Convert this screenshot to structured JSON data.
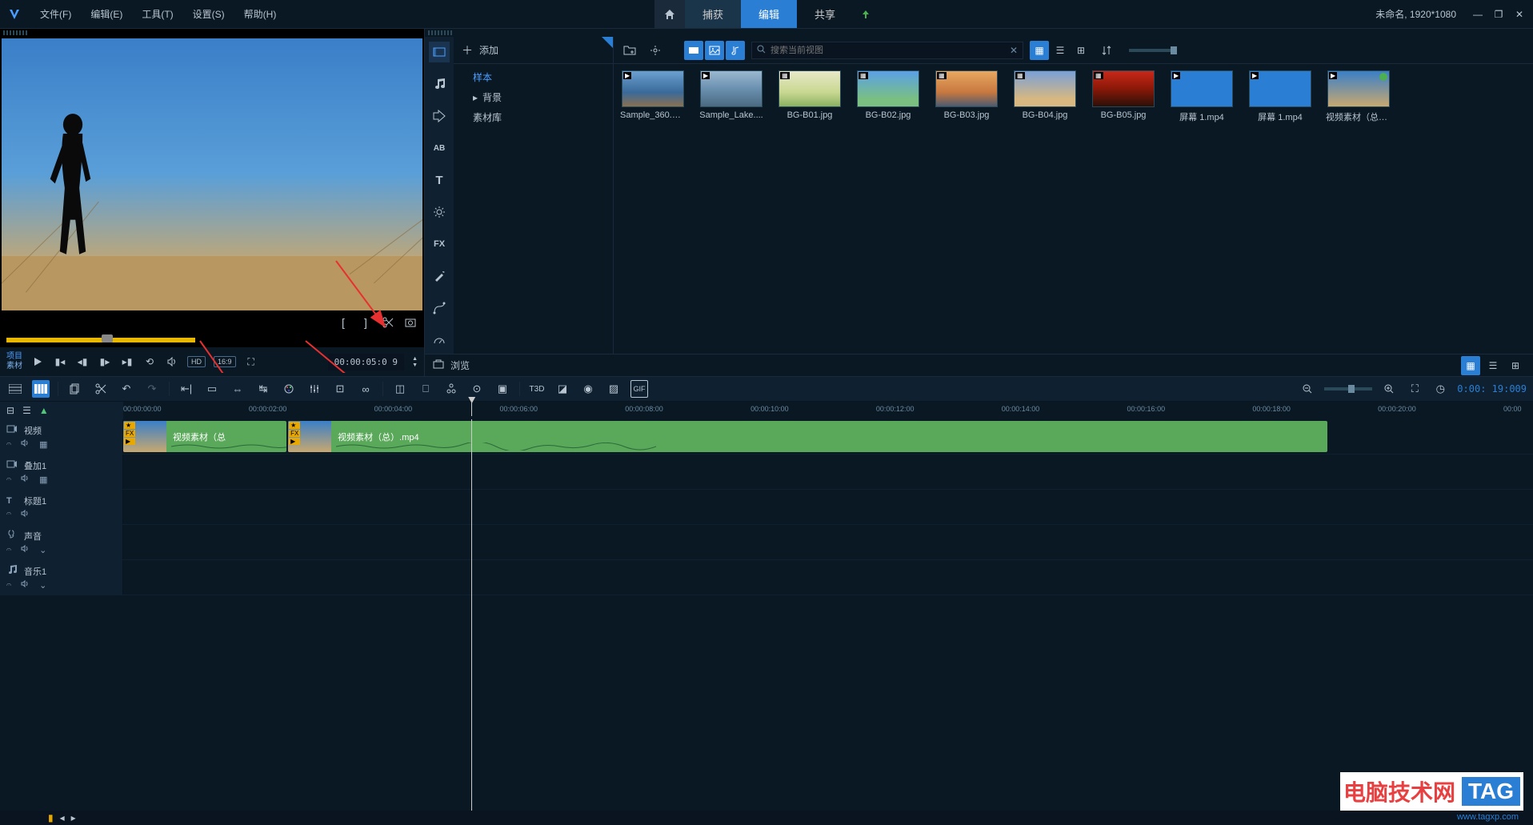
{
  "window": {
    "doc_status": "未命名, 1920*1080"
  },
  "menu": {
    "file": "文件(F)",
    "edit": "编辑(E)",
    "tools": "工具(T)",
    "settings": "设置(S)",
    "help": "帮助(H)"
  },
  "tabs": {
    "capture": "捕获",
    "edit": "编辑",
    "share": "共享"
  },
  "preview": {
    "mode_project": "项目",
    "mode_clip": "素材",
    "hd": "HD",
    "ratio": "16:9",
    "timecode": "00:00:05:0 9"
  },
  "library": {
    "add": "添加",
    "browse": "浏览",
    "tree": {
      "sample": "样本",
      "background": "背景",
      "assets": "素材库"
    },
    "search_placeholder": "搜索当前视图",
    "items": [
      {
        "label": "Sample_360.m...",
        "type": "video",
        "bg": "linear-gradient(180deg,#6aa0d0 0%,#3a6a9a 60%,#8a7050 100%)"
      },
      {
        "label": "Sample_Lake....",
        "type": "video",
        "bg": "linear-gradient(180deg,#9ab8d0 0%,#6a90b0 50%,#4a6a80 100%)"
      },
      {
        "label": "BG-B01.jpg",
        "type": "img",
        "bg": "linear-gradient(180deg,#e8e8c8 0%,#c8d890 60%,#8ab060 100%)"
      },
      {
        "label": "BG-B02.jpg",
        "type": "img",
        "bg": "linear-gradient(180deg,#5aa0e8 0%,#7ac080 80%)"
      },
      {
        "label": "BG-B03.jpg",
        "type": "img",
        "bg": "linear-gradient(180deg,#e8a860 0%,#c87840 60%,#4a5a70 100%)"
      },
      {
        "label": "BG-B04.jpg",
        "type": "img",
        "bg": "linear-gradient(180deg,#7aa0d8 0%,#d8b880 80%)"
      },
      {
        "label": "BG-B05.jpg",
        "type": "img",
        "bg": "linear-gradient(180deg,#c82818 0%,#8a1808 50%,#2a1008 100%)"
      },
      {
        "label": "屏幕 1.mp4",
        "type": "video",
        "bg": "linear-gradient(180deg,#2a7fd4 0%,#2a7fd4 100%)"
      },
      {
        "label": "屏幕 1.mp4",
        "type": "video",
        "bg": "linear-gradient(180deg,#2a7fd4 0%,#2a7fd4 100%)"
      },
      {
        "label": "视频素材（总）...",
        "type": "video",
        "bg": "linear-gradient(180deg,#3a7fc8 0%,#c8a870 100%)",
        "checked": true
      }
    ]
  },
  "timeline": {
    "timecode": "0:00: 19:009",
    "ruler": [
      "00:00:00:00",
      "00:00:02:00",
      "00:00:04:00",
      "00:00:06:00",
      "00:00:08:00",
      "00:00:10:00",
      "00:00:12:00",
      "00:00:14:00",
      "00:00:16:00",
      "00:00:18:00",
      "00:00:20:00",
      "00:00"
    ],
    "tracks": [
      {
        "name": "视频",
        "type": "video"
      },
      {
        "name": "叠加1",
        "type": "overlay"
      },
      {
        "name": "标题1",
        "type": "title"
      },
      {
        "name": "声音",
        "type": "voice"
      },
      {
        "name": "音乐1",
        "type": "music"
      }
    ],
    "clips": [
      {
        "label": "视频素材（总",
        "start_pct": 0,
        "width_pct": 11.6
      },
      {
        "label": "视频素材（总）.mp4",
        "start_pct": 11.7,
        "width_pct": 73.7
      }
    ],
    "playhead_pct": 24.7,
    "t3d": "T3D"
  },
  "watermark": {
    "t1": "电脑技术网",
    "t2": "TAG",
    "url": "www.tagxp.com"
  }
}
